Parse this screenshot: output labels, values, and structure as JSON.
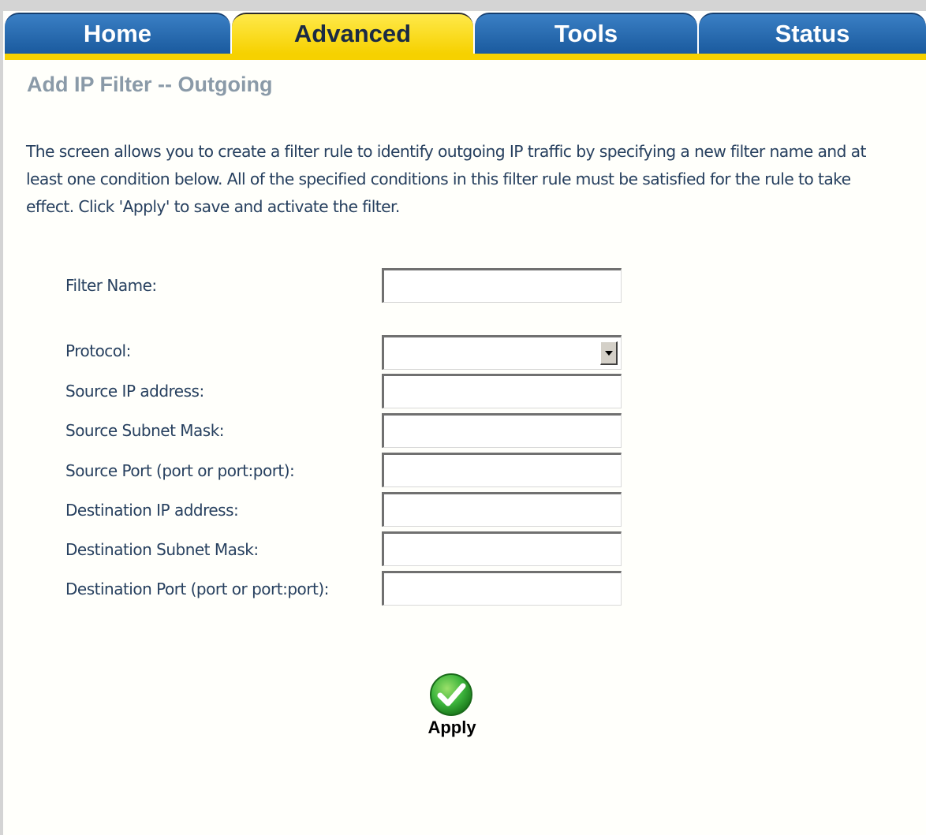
{
  "tabs": [
    {
      "label": "Home",
      "active": false
    },
    {
      "label": "Advanced",
      "active": true
    },
    {
      "label": "Tools",
      "active": false
    },
    {
      "label": "Status",
      "active": false
    }
  ],
  "page_title": "Add IP Filter -- Outgoing",
  "description": "The screen allows you to create a filter rule to identify outgoing IP traffic by specifying a new filter name and at least one condition below. All of the specified conditions in this filter rule must be satisfied for the rule to take effect. Click 'Apply' to save and activate the filter.",
  "form": {
    "filter_name": {
      "label": "Filter Name:",
      "value": ""
    },
    "protocol": {
      "label": "Protocol:",
      "value": ""
    },
    "source_ip": {
      "label": "Source IP address:",
      "value": ""
    },
    "source_mask": {
      "label": "Source Subnet Mask:",
      "value": ""
    },
    "source_port": {
      "label": "Source Port (port or port:port):",
      "value": ""
    },
    "dest_ip": {
      "label": "Destination IP address:",
      "value": ""
    },
    "dest_mask": {
      "label": "Destination Subnet Mask:",
      "value": ""
    },
    "dest_port": {
      "label": "Destination Port (port or port:port):",
      "value": ""
    }
  },
  "apply": {
    "label": "Apply",
    "icon": "green-checkmark-icon"
  },
  "colors": {
    "tab_blue": "#1a5a9e",
    "tab_active_yellow": "#f6d100",
    "title_gray": "#8a9aa8",
    "text_navy": "#27405f",
    "apply_green": "#3cb43c"
  }
}
